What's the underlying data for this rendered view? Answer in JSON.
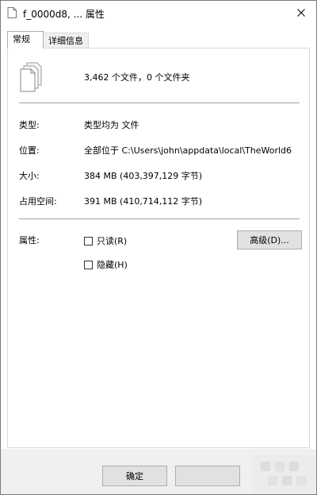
{
  "window": {
    "title": "f_0000d8, ... 属性",
    "title_icon": "file-icon",
    "close_icon": "close-icon"
  },
  "tabs": [
    {
      "label": "常规",
      "selected": true
    },
    {
      "label": "详细信息",
      "selected": false
    }
  ],
  "general": {
    "icon": "multiple-files-icon",
    "file_count": "3,462 个文件，0 个文件夹",
    "rows": [
      {
        "label": "类型:",
        "value": "类型均为 文件"
      },
      {
        "label": "位置:",
        "value": "全部位于 C:\\Users\\john\\appdata\\local\\TheWorld6"
      },
      {
        "label": "大小:",
        "value": "384 MB (403,397,129 字节)"
      },
      {
        "label": "占用空间:",
        "value": "391 MB (410,714,112 字节)"
      }
    ],
    "attributes": {
      "label": "属性:",
      "readonly": {
        "label": "只读(R)",
        "checked": false
      },
      "hidden": {
        "label": "隐藏(H)",
        "checked": false
      },
      "advanced_button": "高级(D)..."
    }
  },
  "footer": {
    "ok_button": "确定",
    "cancel_button": ""
  },
  "colors": {
    "background": "#ffffff",
    "footer": "#f0f0f0",
    "button": "#e1e1e1",
    "button_border": "#adadad",
    "separator": "#a0a0a0"
  }
}
